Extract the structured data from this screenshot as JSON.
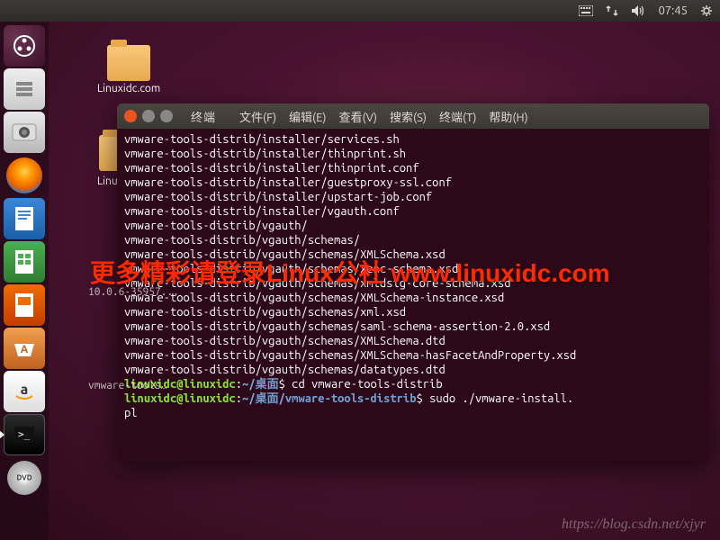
{
  "topbar": {
    "time": "07:45"
  },
  "launcher": {
    "items": [
      {
        "name": "dash"
      },
      {
        "name": "files"
      },
      {
        "name": "photo"
      },
      {
        "name": "firefox"
      },
      {
        "name": "libreoffice-writer"
      },
      {
        "name": "libreoffice-calc"
      },
      {
        "name": "libreoffice-impress"
      },
      {
        "name": "ubuntu-software"
      },
      {
        "name": "amazon"
      },
      {
        "name": "terminal"
      },
      {
        "name": "disc"
      }
    ]
  },
  "desktop_icons": [
    {
      "label": "Linuxidc.com"
    },
    {
      "label": "Linux公社"
    },
    {
      "label": "10.0.6-35957..."
    },
    {
      "label": "vmware-tools…"
    }
  ],
  "terminal": {
    "title": "终端",
    "menu": {
      "file": "文件(F)",
      "edit": "编辑(E)",
      "view": "查看(V)",
      "search": "搜索(S)",
      "terminal": "终端(T)",
      "help": "帮助(H)"
    },
    "lines": [
      "vmware-tools-distrib/installer/services.sh",
      "vmware-tools-distrib/installer/thinprint.sh",
      "vmware-tools-distrib/installer/thinprint.conf",
      "vmware-tools-distrib/installer/guestproxy-ssl.conf",
      "vmware-tools-distrib/installer/upstart-job.conf",
      "vmware-tools-distrib/installer/vgauth.conf",
      "vmware-tools-distrib/vgauth/",
      "vmware-tools-distrib/vgauth/schemas/",
      "vmware-tools-distrib/vgauth/schemas/XMLSchema.xsd",
      "vmware-tools-distrib/vgauth/schemas/xenc-schema.xsd",
      "vmware-tools-distrib/vgauth/schemas/xmldsig-core-schema.xsd",
      "vmware-tools-distrib/vgauth/schemas/XMLSchema-instance.xsd",
      "vmware-tools-distrib/vgauth/schemas/xml.xsd",
      "vmware-tools-distrib/vgauth/schemas/saml-schema-assertion-2.0.xsd",
      "vmware-tools-distrib/vgauth/schemas/XMLSchema.dtd",
      "vmware-tools-distrib/vgauth/schemas/XMLSchema-hasFacetAndProperty.xsd",
      "vmware-tools-distrib/vgauth/schemas/datatypes.dtd"
    ],
    "prompt1": {
      "userhost": "linuxidc@linuxidc",
      "sep": ":",
      "path": "~/桌面",
      "dollar": "$ ",
      "cmd": "cd vmware-tools-distrib"
    },
    "prompt2": {
      "userhost": "linuxidc@linuxidc",
      "sep": ":",
      "path": "~/桌面/vmware-tools-distrib",
      "dollar": "$ ",
      "cmd": "sudo ./vmware-install.",
      "cmd_cont": "pl"
    }
  },
  "watermarks": {
    "red": "更多精彩请登录Linux公社 www.linuxidc.com",
    "csdn": "https://blog.csdn.net/xjyr"
  }
}
